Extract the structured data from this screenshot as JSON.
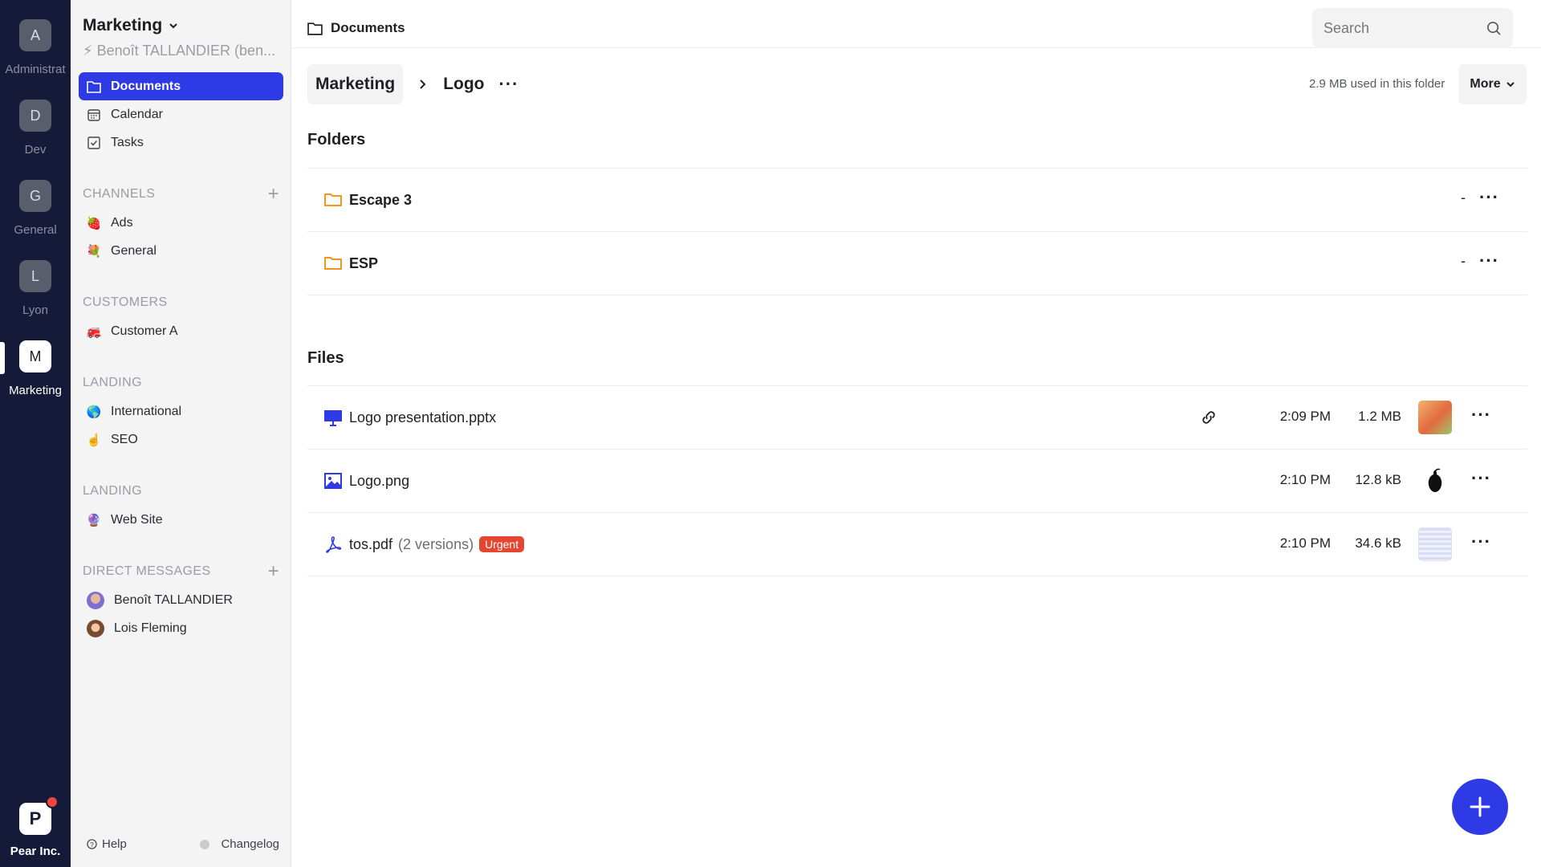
{
  "workspaces": [
    {
      "initial": "A",
      "label": "Administrat"
    },
    {
      "initial": "D",
      "label": "Dev"
    },
    {
      "initial": "G",
      "label": "General"
    },
    {
      "initial": "L",
      "label": "Lyon"
    },
    {
      "initial": "M",
      "label": "Marketing"
    }
  ],
  "org": {
    "initial": "P",
    "label": "Pear Inc."
  },
  "sidebar": {
    "title": "Marketing",
    "user": "⚡ Benoît TALLANDIER (ben...",
    "nav": [
      {
        "label": "Documents",
        "icon": "folder-icon"
      },
      {
        "label": "Calendar",
        "icon": "calendar-icon"
      },
      {
        "label": "Tasks",
        "icon": "checkbox-icon"
      }
    ],
    "sections": [
      {
        "title": "CHANNELS",
        "items": [
          {
            "emoji": "🍓",
            "label": "Ads"
          },
          {
            "emoji": "💐",
            "label": "General"
          }
        ]
      },
      {
        "title": "CUSTOMERS",
        "items": [
          {
            "emoji": "🚒",
            "label": "Customer A"
          }
        ]
      },
      {
        "title": "LANDING",
        "items": [
          {
            "emoji": "🌎",
            "label": "International"
          },
          {
            "emoji": "☝️",
            "label": "SEO"
          }
        ]
      },
      {
        "title": "LANDING",
        "items": [
          {
            "emoji": "🔮",
            "label": "Web Site"
          }
        ]
      },
      {
        "title": "DIRECT MESSAGES",
        "items": [
          {
            "label": "Benoît TALLANDIER"
          },
          {
            "label": "Lois Fleming"
          }
        ]
      }
    ],
    "footer": {
      "help": "Help",
      "changelog": "Changelog"
    }
  },
  "topbar": {
    "crumb": "Documents",
    "search_placeholder": "Search"
  },
  "path": {
    "parent": "Marketing",
    "current": "Logo",
    "usage": "2.9 MB used in this folder",
    "more": "More"
  },
  "folders_title": "Folders",
  "folders": [
    {
      "name": "Escape 3",
      "size": "-"
    },
    {
      "name": "ESP",
      "size": "-"
    }
  ],
  "files_title": "Files",
  "files": [
    {
      "name": "Logo presentation.pptx",
      "versions": "",
      "badge": "",
      "time": "2:09 PM",
      "size": "1.2 MB"
    },
    {
      "name": "Logo.png",
      "versions": "",
      "badge": "",
      "time": "2:10 PM",
      "size": "12.8 kB"
    },
    {
      "name": "tos.pdf",
      "versions": "(2 versions)",
      "badge": "Urgent",
      "time": "2:10 PM",
      "size": "34.6 kB"
    }
  ],
  "colors": {
    "rail": "#141a38",
    "accent": "#2d3ae6",
    "folder": "#f39320",
    "badge": "#e5462f"
  }
}
